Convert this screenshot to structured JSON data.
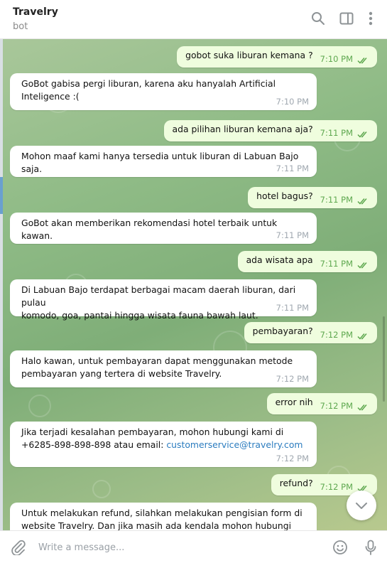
{
  "header": {
    "title": "Travelry",
    "subtitle": "bot"
  },
  "composer": {
    "placeholder": "Write a message..."
  },
  "messages": [
    {
      "dir": "out",
      "text": "gobot suka liburan kemana ?",
      "time": "7:10 PM"
    },
    {
      "dir": "in",
      "lines": [
        "GoBot gabisa pergi liburan, karena aku hanyalah Artificial",
        "Inteligence :("
      ],
      "time": "7:10 PM"
    },
    {
      "dir": "out",
      "text": "ada pilihan liburan kemana aja?",
      "time": "7:11 PM"
    },
    {
      "dir": "in",
      "lines": [
        "Mohon maaf kami hanya tersedia untuk liburan di Labuan Bajo saja."
      ],
      "time": "7:11 PM"
    },
    {
      "dir": "out",
      "text": "hotel bagus?",
      "time": "7:11 PM"
    },
    {
      "dir": "in",
      "lines": [
        "GoBot akan memberikan rekomendasi hotel terbaik untuk kawan."
      ],
      "time": "7:11 PM"
    },
    {
      "dir": "out",
      "text": "ada wisata apa",
      "time": "7:11 PM"
    },
    {
      "dir": "in",
      "lines": [
        "Di Labuan Bajo terdapat berbagai macam daerah liburan, dari pulau",
        "komodo, goa, pantai hingga wisata fauna bawah laut."
      ],
      "time": "7:11 PM"
    },
    {
      "dir": "out",
      "text": "pembayaran?",
      "time": "7:12 PM"
    },
    {
      "dir": "in",
      "lines": [
        "Halo kawan, untuk pembayaran dapat menggunakan metode",
        "pembayaran yang tertera di website Travelry."
      ],
      "time": "7:12 PM"
    },
    {
      "dir": "out",
      "text": "error nih",
      "time": "7:12 PM"
    },
    {
      "dir": "in",
      "lines": [
        "Jika terjadi kesalahan pembayaran, mohon hubungi kami di",
        "+6285-898-898-898 atau email: "
      ],
      "link": "customerservice@travelry.com",
      "time": "7:12 PM"
    },
    {
      "dir": "out",
      "text": "refund?",
      "time": "7:12 PM"
    },
    {
      "dir": "in",
      "lines": [
        "Untuk melakukan refund, silahkan melakukan pengisian form di",
        "website Travelry. Dan jika masih ada kendala mohon hubungi kami"
      ],
      "time": ""
    }
  ]
}
